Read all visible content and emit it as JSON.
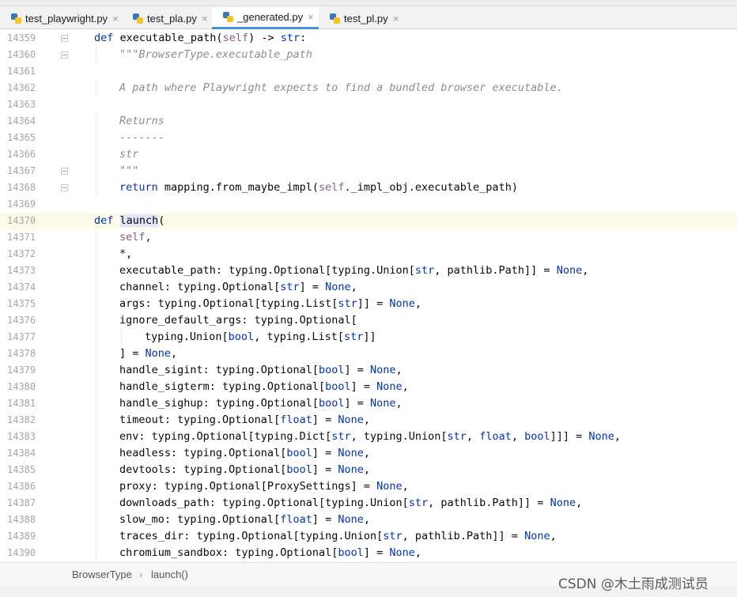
{
  "tabs": [
    {
      "label": "test_playwright.py",
      "active": false
    },
    {
      "label": "test_pla.py",
      "active": false
    },
    {
      "label": "_generated.py",
      "active": true
    },
    {
      "label": "test_pl.py",
      "active": false
    }
  ],
  "lines": [
    {
      "num": "14359",
      "fold": true,
      "indent": 0,
      "tokens": [
        [
          "kw",
          "def "
        ],
        [
          "",
          "executable_path("
        ],
        [
          "self",
          "self"
        ],
        [
          "",
          ") -> "
        ],
        [
          "kw",
          "str"
        ],
        [
          "",
          ":"
        ]
      ]
    },
    {
      "num": "14360",
      "fold": true,
      "indent": 1,
      "tokens": [
        [
          "doc",
          "\"\"\"BrowserType.executable_path"
        ]
      ]
    },
    {
      "num": "14361",
      "indent": 0,
      "tokens": []
    },
    {
      "num": "14362",
      "indent": 1,
      "tokens": [
        [
          "doc",
          "A path where Playwright expects to find a bundled browser executable."
        ]
      ]
    },
    {
      "num": "14363",
      "indent": 0,
      "tokens": []
    },
    {
      "num": "14364",
      "indent": 1,
      "tokens": [
        [
          "doc",
          "Returns"
        ]
      ]
    },
    {
      "num": "14365",
      "indent": 1,
      "tokens": [
        [
          "doc",
          "-------"
        ]
      ]
    },
    {
      "num": "14366",
      "indent": 1,
      "tokens": [
        [
          "doc",
          "str"
        ]
      ]
    },
    {
      "num": "14367",
      "fold": true,
      "indent": 1,
      "tokens": [
        [
          "doc",
          "\"\"\""
        ]
      ]
    },
    {
      "num": "14368",
      "fold": true,
      "indent": 1,
      "tokens": [
        [
          "kw",
          "return "
        ],
        [
          "",
          "mapping.from_maybe_impl("
        ],
        [
          "self",
          "self"
        ],
        [
          "",
          "._impl_obj.executable_path)"
        ]
      ]
    },
    {
      "num": "14369",
      "indent": 0,
      "tokens": []
    },
    {
      "num": "14370",
      "current": true,
      "indent": 0,
      "tokens": [
        [
          "kw",
          "def "
        ],
        [
          "hl",
          "launch"
        ],
        [
          "",
          "("
        ]
      ]
    },
    {
      "num": "14371",
      "indent": 1,
      "tokens": [
        [
          "self",
          "self"
        ],
        [
          "",
          ","
        ]
      ]
    },
    {
      "num": "14372",
      "indent": 1,
      "tokens": [
        [
          "",
          "*,"
        ]
      ]
    },
    {
      "num": "14373",
      "indent": 1,
      "tokens": [
        [
          "",
          "executable_path: typing.Optional[typing.Union["
        ],
        [
          "kw",
          "str"
        ],
        [
          "",
          ", pathlib.Path]] = "
        ],
        [
          "none",
          "None"
        ],
        [
          "",
          ","
        ]
      ]
    },
    {
      "num": "14374",
      "indent": 1,
      "tokens": [
        [
          "",
          "channel: typing.Optional["
        ],
        [
          "kw",
          "str"
        ],
        [
          "",
          "] = "
        ],
        [
          "none",
          "None"
        ],
        [
          "",
          ","
        ]
      ]
    },
    {
      "num": "14375",
      "indent": 1,
      "tokens": [
        [
          "",
          "args: typing.Optional[typing.List["
        ],
        [
          "kw",
          "str"
        ],
        [
          "",
          "]] = "
        ],
        [
          "none",
          "None"
        ],
        [
          "",
          ","
        ]
      ]
    },
    {
      "num": "14376",
      "indent": 1,
      "tokens": [
        [
          "",
          "ignore_default_args: typing.Optional["
        ]
      ]
    },
    {
      "num": "14377",
      "indent": 2,
      "tokens": [
        [
          "",
          "typing.Union["
        ],
        [
          "kw",
          "bool"
        ],
        [
          "",
          ", typing.List["
        ],
        [
          "kw",
          "str"
        ],
        [
          "",
          "]]"
        ]
      ]
    },
    {
      "num": "14378",
      "indent": 1,
      "tokens": [
        [
          "",
          "] = "
        ],
        [
          "none",
          "None"
        ],
        [
          "",
          ","
        ]
      ]
    },
    {
      "num": "14379",
      "indent": 1,
      "tokens": [
        [
          "",
          "handle_sigint: typing.Optional["
        ],
        [
          "kw",
          "bool"
        ],
        [
          "",
          "] = "
        ],
        [
          "none",
          "None"
        ],
        [
          "",
          ","
        ]
      ]
    },
    {
      "num": "14380",
      "indent": 1,
      "tokens": [
        [
          "",
          "handle_sigterm: typing.Optional["
        ],
        [
          "kw",
          "bool"
        ],
        [
          "",
          "] = "
        ],
        [
          "none",
          "None"
        ],
        [
          "",
          ","
        ]
      ]
    },
    {
      "num": "14381",
      "indent": 1,
      "tokens": [
        [
          "",
          "handle_sighup: typing.Optional["
        ],
        [
          "kw",
          "bool"
        ],
        [
          "",
          "] = "
        ],
        [
          "none",
          "None"
        ],
        [
          "",
          ","
        ]
      ]
    },
    {
      "num": "14382",
      "indent": 1,
      "tokens": [
        [
          "",
          "timeout: typing.Optional["
        ],
        [
          "kw",
          "float"
        ],
        [
          "",
          "] = "
        ],
        [
          "none",
          "None"
        ],
        [
          "",
          ","
        ]
      ]
    },
    {
      "num": "14383",
      "indent": 1,
      "tokens": [
        [
          "",
          "env: typing.Optional[typing.Dict["
        ],
        [
          "kw",
          "str"
        ],
        [
          "",
          ", typing.Union["
        ],
        [
          "kw",
          "str"
        ],
        [
          "",
          ", "
        ],
        [
          "kw",
          "float"
        ],
        [
          "",
          ", "
        ],
        [
          "kw",
          "bool"
        ],
        [
          "",
          "]]] = "
        ],
        [
          "none",
          "None"
        ],
        [
          "",
          ","
        ]
      ]
    },
    {
      "num": "14384",
      "indent": 1,
      "tokens": [
        [
          "",
          "headless: typing.Optional["
        ],
        [
          "kw",
          "bool"
        ],
        [
          "",
          "] = "
        ],
        [
          "none",
          "None"
        ],
        [
          "",
          ","
        ]
      ]
    },
    {
      "num": "14385",
      "indent": 1,
      "tokens": [
        [
          "",
          "devtools: typing.Optional["
        ],
        [
          "kw",
          "bool"
        ],
        [
          "",
          "] = "
        ],
        [
          "none",
          "None"
        ],
        [
          "",
          ","
        ]
      ]
    },
    {
      "num": "14386",
      "indent": 1,
      "tokens": [
        [
          "",
          "proxy: typing.Optional[ProxySettings] = "
        ],
        [
          "none",
          "None"
        ],
        [
          "",
          ","
        ]
      ]
    },
    {
      "num": "14387",
      "indent": 1,
      "tokens": [
        [
          "",
          "downloads_path: typing.Optional[typing.Union["
        ],
        [
          "kw",
          "str"
        ],
        [
          "",
          ", pathlib.Path]] = "
        ],
        [
          "none",
          "None"
        ],
        [
          "",
          ","
        ]
      ]
    },
    {
      "num": "14388",
      "indent": 1,
      "tokens": [
        [
          "",
          "slow_mo: typing.Optional["
        ],
        [
          "kw",
          "float"
        ],
        [
          "",
          "] = "
        ],
        [
          "none",
          "None"
        ],
        [
          "",
          ","
        ]
      ]
    },
    {
      "num": "14389",
      "indent": 1,
      "tokens": [
        [
          "",
          "traces_dir: typing.Optional[typing.Union["
        ],
        [
          "kw",
          "str"
        ],
        [
          "",
          ", pathlib.Path]] = "
        ],
        [
          "none",
          "None"
        ],
        [
          "",
          ","
        ]
      ]
    },
    {
      "num": "14390",
      "indent": 1,
      "tokens": [
        [
          "",
          "chromium_sandbox: typing.Optional["
        ],
        [
          "kw",
          "bool"
        ],
        [
          "",
          "] = "
        ],
        [
          "none",
          "None"
        ],
        [
          "",
          ","
        ]
      ]
    }
  ],
  "breadcrumb": {
    "class": "BrowserType",
    "separator": "›",
    "method": "launch()"
  },
  "watermark": "CSDN @木土雨成测试员",
  "colors": {
    "keyword": "#0033b3",
    "self": "#94558d",
    "docstring": "#8c8c8c",
    "tab_underline": "#4a8fd6",
    "current_line": "#fcfae8"
  }
}
